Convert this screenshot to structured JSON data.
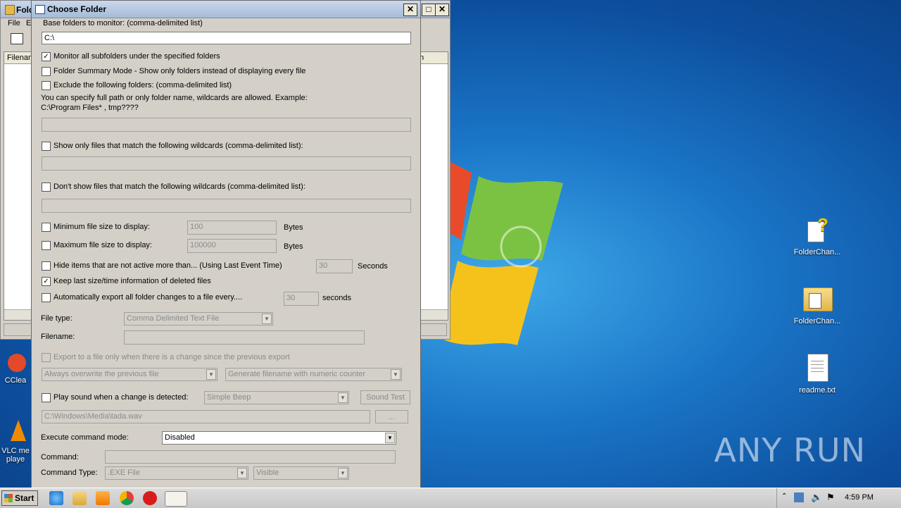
{
  "desktop": {
    "icons": [
      {
        "label": "FolderChan..."
      },
      {
        "label": "FolderChan..."
      },
      {
        "label": "readme.txt"
      }
    ],
    "left_icons": [
      {
        "label": "CClea"
      },
      {
        "label": "VLC me"
      },
      {
        "label": "playe"
      }
    ],
    "watermark": "ANY RUN"
  },
  "bg_window": {
    "title": "Fold",
    "menu": [
      "File",
      "E"
    ],
    "col_left": "Filenam",
    "col_right": "n"
  },
  "dialog": {
    "title": "Choose Folder",
    "base_label": "Base folders to monitor:  (comma-delimited list)",
    "base_value": "C:\\",
    "monitor_sub": "Monitor all subfolders under the specified folders",
    "summary_mode": "Folder Summary Mode - Show only folders instead of displaying every file",
    "exclude": "Exclude the following folders: (comma-delimited list)",
    "exclude_hint1": "You can specify full path or only folder name, wildcards are allowed. Example:",
    "exclude_hint2": "C:\\Program Files* , tmp????",
    "show_only": "Show only files that match the following wildcards (comma-delimited list):",
    "dont_show": "Don't show files that match the following wildcards (comma-delimited list):",
    "min_size": "Minimum file size to display:",
    "min_value": "100",
    "max_size": "Maximum file size to display:",
    "max_value": "100000",
    "bytes": "Bytes",
    "hide_inactive": "Hide items that are not active more than... (Using Last Event Time)",
    "hide_value": "30",
    "seconds_cap": "Seconds",
    "keep_last": "Keep last size/time information of deleted files",
    "auto_export": "Automatically export all folder changes to a file every....",
    "export_value": "30",
    "seconds": "seconds",
    "file_type_label": "File type:",
    "file_type": "Comma Delimited Text File",
    "filename_label": "Filename:",
    "export_change": "Export to a file only when there is a change since the previous export",
    "overwrite": "Always overwrite the previous file",
    "generate": "Generate filename with numeric counter",
    "play_sound": "Play sound when a change is detected:",
    "sound_type": "Simple Beep",
    "sound_test": "Sound Test",
    "sound_file": "C:\\Windows\\Media\\tada.wav",
    "browse": "...",
    "exec_label": "Execute command mode:",
    "exec_value": "Disabled",
    "command_label": "Command:",
    "command_type_label": "Command Type:",
    "command_type": ".EXE File",
    "visible": "Visible"
  },
  "taskbar": {
    "start": "Start",
    "time": "4:59 PM"
  }
}
